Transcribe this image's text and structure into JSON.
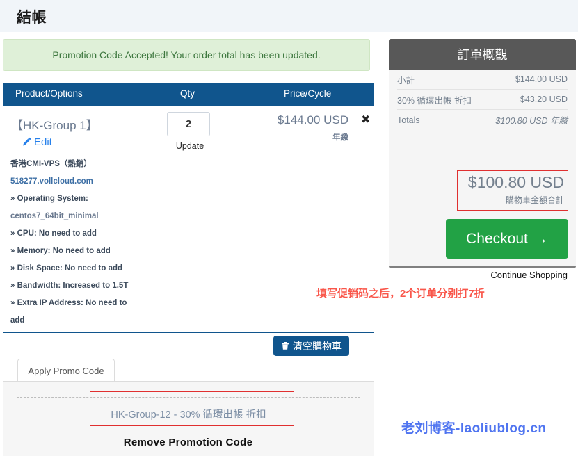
{
  "page": {
    "title": "結帳",
    "alert_message": "Promotion Code Accepted! Your order total has been updated."
  },
  "cart_table": {
    "headers": {
      "product": "Product/Options",
      "qty": "Qty",
      "price": "Price/Cycle"
    },
    "row": {
      "product_name": "【HK-Group 1】",
      "edit_label": "Edit",
      "edit_icon": "pencil-icon",
      "spec_plan": "香港CMI-VPS（熱銷）",
      "spec_domain": "518277.vollcloud.com",
      "spec_lines": [
        "» Operating System:",
        "centos7_64bit_minimal",
        "» CPU: No need to add",
        "» Memory: No need to add",
        "» Disk Space: No need to add",
        "» Bandwidth: Increased to 1.5T",
        "» Extra IP Address: No need to",
        "add"
      ],
      "qty_value": "2",
      "update_label": "Update",
      "price": "$144.00 USD",
      "cycle": "年繳",
      "remove_icon": "close-icon",
      "remove_glyph": "✖"
    }
  },
  "actions": {
    "clear_cart_label": "清空購物車",
    "clear_cart_icon": "trash-icon"
  },
  "promo": {
    "tab_label": "Apply Promo Code",
    "applied_code": "HK-Group-12 - 30% 循環出帳 折扣",
    "remove_label": "Remove Promotion Code"
  },
  "summary": {
    "heading": "訂單概觀",
    "rows": [
      {
        "label": "小計",
        "value": "$144.00 USD"
      },
      {
        "label": "30% 循環出帳 折扣",
        "value": "$43.20 USD"
      },
      {
        "label": "Totals",
        "value": "$100.80 USD 年繳"
      }
    ],
    "total_amount": "$100.80 USD",
    "total_label": "購物車金額合計",
    "checkout_label": "Checkout",
    "checkout_arrow": "→",
    "continue_label": "Continue Shopping"
  },
  "annotations": {
    "note_text": "填写促销码之后，2个订单分别打7折",
    "watermark": "老刘博客-laoliublog.cn"
  },
  "colors": {
    "table_header": "#10558d",
    "alert_bg": "#dff0d8",
    "alert_text": "#3c763d",
    "summary_header": "#585858",
    "checkout_green": "#22a245",
    "annotation_red": "#f9564a",
    "highlight_box": "#e03030",
    "watermark_blue": "#4f74f0",
    "link_blue": "#2680eb"
  }
}
